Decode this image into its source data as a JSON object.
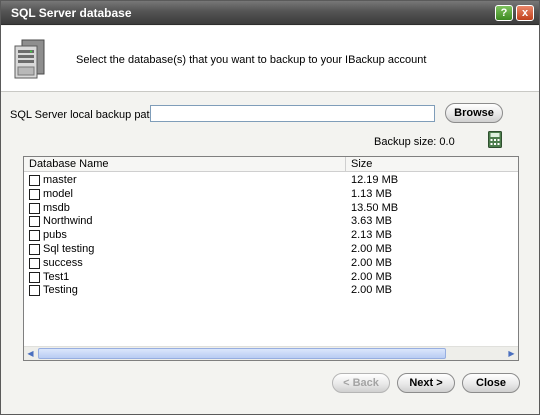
{
  "window": {
    "title": "SQL Server database",
    "help_label": "?",
    "close_label": "x"
  },
  "header": {
    "instruction": "Select the database(s) that you want to backup to your IBackup account",
    "icon": "server-icon"
  },
  "path": {
    "label": "SQL Server local backup path",
    "value": "",
    "browse_label": "Browse"
  },
  "backup_size": {
    "label": "Backup size: 0.0",
    "icon": "calculator-icon"
  },
  "table": {
    "columns": [
      "Database Name",
      "Size"
    ],
    "rows": [
      {
        "name": "master",
        "size": "12.19 MB",
        "checked": false
      },
      {
        "name": "model",
        "size": "1.13 MB",
        "checked": false
      },
      {
        "name": "msdb",
        "size": "13.50 MB",
        "checked": false
      },
      {
        "name": "Northwind",
        "size": "3.63 MB",
        "checked": false
      },
      {
        "name": "pubs",
        "size": "2.13 MB",
        "checked": false
      },
      {
        "name": "Sql testing",
        "size": "2.00 MB",
        "checked": false
      },
      {
        "name": "success",
        "size": "2.00 MB",
        "checked": false
      },
      {
        "name": "Test1",
        "size": "2.00 MB",
        "checked": false
      },
      {
        "name": "Testing",
        "size": "2.00 MB",
        "checked": false
      }
    ]
  },
  "footer": {
    "back_label": "< Back",
    "next_label": "Next >",
    "close_label": "Close"
  }
}
